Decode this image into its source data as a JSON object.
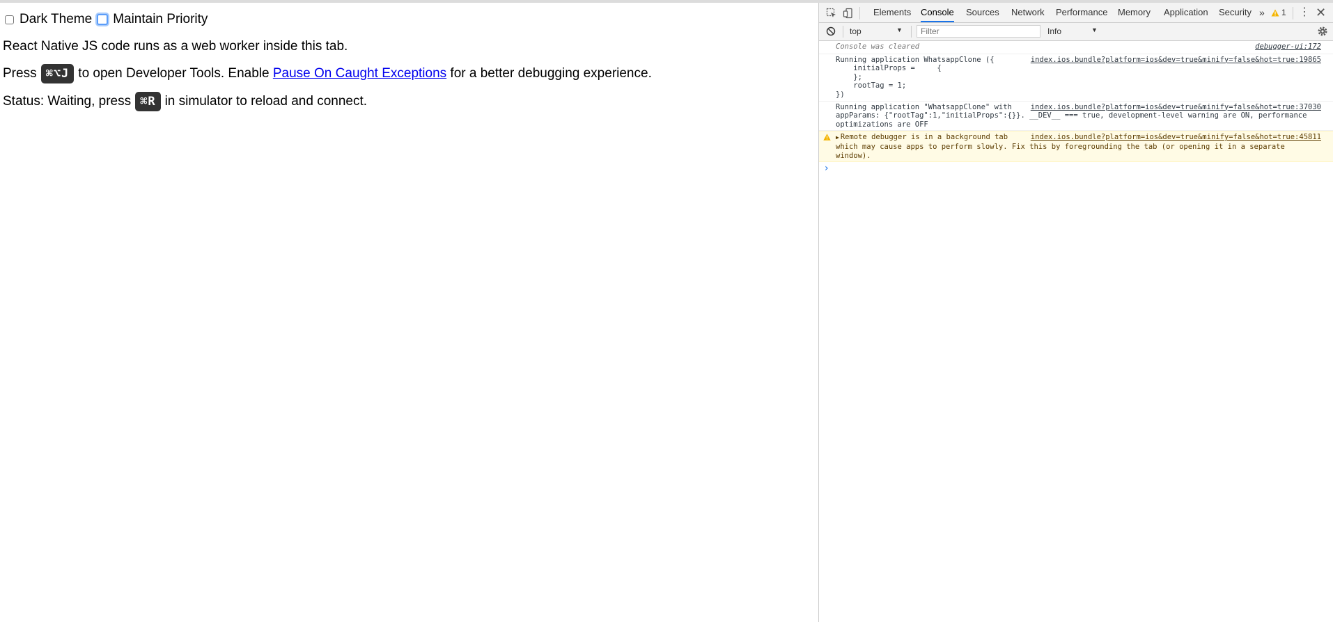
{
  "options": {
    "dark_theme_label": "Dark Theme",
    "maintain_priority_label": "Maintain Priority"
  },
  "page": {
    "line1": "React Native JS code runs as a web worker inside this tab.",
    "line2_before": "Press",
    "line2_shortcut": "⌘⌥J",
    "line2_middle": "to open Developer Tools. Enable",
    "line2_link": "Pause On Caught Exceptions",
    "line2_after": "for a better debugging experience.",
    "line3_before": "Status: Waiting, press",
    "line3_shortcut": "⌘R",
    "line3_after": "in simulator to reload and connect."
  },
  "devtools": {
    "tabs": [
      "Elements",
      "Console",
      "Sources",
      "Network",
      "Performance",
      "Memory",
      "Application",
      "Security"
    ],
    "active_tab": "Console",
    "more_tabs": "»",
    "warning_count": "1",
    "kebab": "⋮",
    "close": "✕",
    "context": "top",
    "filter_placeholder": "Filter",
    "level": "Info",
    "accent_color": "#1a73e8",
    "warning_color": "#f4b400"
  },
  "console": {
    "messages": [
      {
        "type": "cleared",
        "text": "Console was cleared",
        "source": "debugger-ui:172"
      },
      {
        "type": "log",
        "text": "Running application WhatsappClone ({\n    initialProps =     {\n    };\n    rootTag = 1;\n})",
        "source": "index.ios.bundle?platform=ios&dev=true&minify=false&hot=true:19865"
      },
      {
        "type": "log",
        "text": "Running application \"WhatsappClone\" with appParams: {\"rootTag\":1,\"initialProps\":{}}. __DEV__ === true, development-level warning are ON, performance optimizations are OFF",
        "source": "index.ios.bundle?platform=ios&dev=true&minify=false&hot=true:37030"
      },
      {
        "type": "warning",
        "text": "Remote debugger is in a background tab which may cause apps to perform slowly. Fix this by foregrounding the tab (or opening it in a separate window).",
        "source": "index.ios.bundle?platform=ios&dev=true&minify=false&hot=true:45811"
      }
    ],
    "prompt": "›"
  }
}
